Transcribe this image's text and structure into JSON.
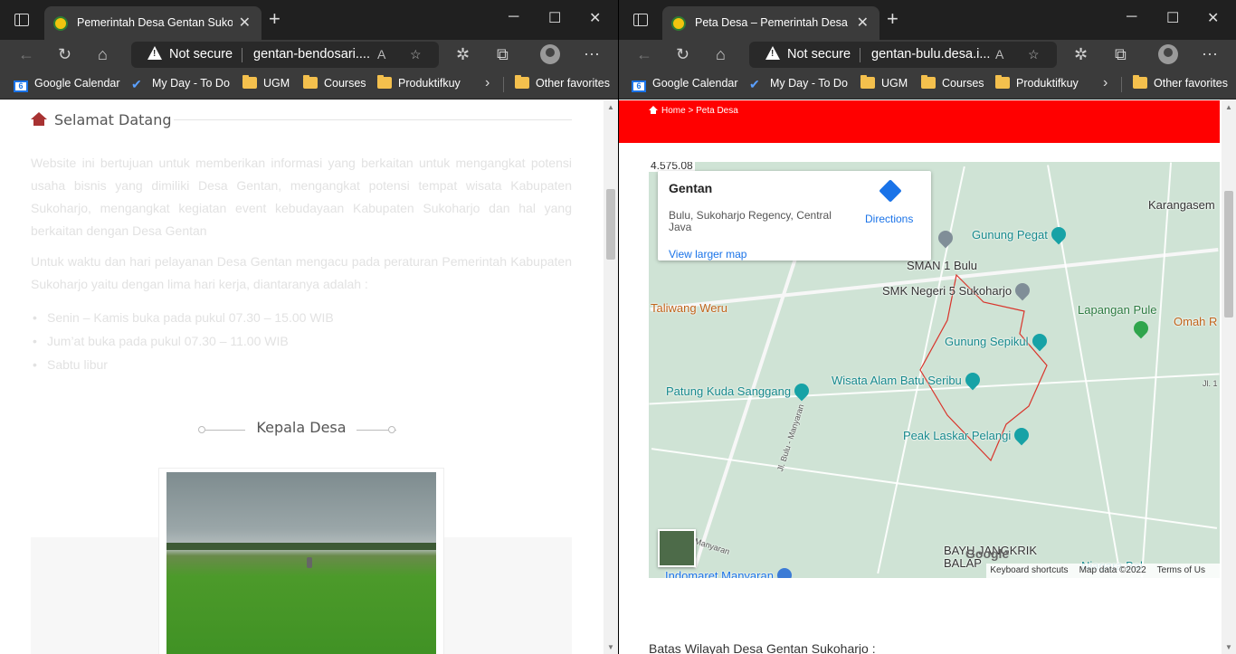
{
  "left_window": {
    "tab_title": "Pemerintah Desa Gentan Sukoharjo",
    "address": {
      "security": "Not secure",
      "url": "gentan-bendosari...."
    },
    "bookmarks": [
      "Google Calendar",
      "My Day - To Do",
      "UGM",
      "Courses",
      "Produktifkuy"
    ],
    "other_favorites": "Other favorites",
    "page": {
      "section_title": "Selamat Datang",
      "paragraph1": "Website ini bertujuan untuk memberikan informasi yang berkaitan untuk mengangkat potensi usaha bisnis yang dimiliki Desa Gentan, mengangkat potensi tempat wisata Kabupaten Sukoharjo, mengangkat kegiatan event kebudayaan Kabupaten Sukoharjo dan hal yang berkaitan dengan Desa Gentan",
      "paragraph2": "Untuk waktu dan hari pelayanan Desa Gentan mengacu pada peraturan Pemerintah Kabupaten Sukoharjo yaitu dengan lima hari kerja, diantaranya adalah :",
      "schedule": [
        "Senin – Kamis buka pada pukul 07.30 – 15.00 WIB",
        "Jum’at buka pada pukul 07.30 – 11.00 WIB",
        "Sabtu libur"
      ],
      "kepala_title": "Kepala Desa"
    }
  },
  "right_window": {
    "tab_title": "Peta Desa – Pemerintah Desa Gentan",
    "address": {
      "security": "Not secure",
      "url": "gentan-bulu.desa.i..."
    },
    "bookmarks": [
      "Google Calendar",
      "My Day - To Do",
      "UGM",
      "Courses",
      "Produktifkuy"
    ],
    "other_favorites": "Other favorites",
    "page": {
      "breadcrumb_home": "Home",
      "breadcrumb_current": "Peta Desa",
      "map": {
        "coord_fragment": "4.575.08",
        "card_title": "Gentan",
        "card_address": "Bulu, Sukoharjo Regency, Central Java",
        "card_link": "View larger map",
        "directions": "Directions",
        "places": {
          "karangasem": "Karangasem",
          "gunung_pegat": "Gunung Pegat",
          "sman1": "SMAN 1 Bulu",
          "smk5": "SMK Negeri 5 Sukoharjo",
          "taliwang": "Taliwang Weru",
          "lapangan": "Lapangan Pule",
          "omah": "Omah R",
          "sepikul": "Gunung Sepikul",
          "batu_seribu": "Wisata Alam Batu Seribu",
          "patung": "Patung Kuda Sanggang",
          "peak": "Peak Laskar Pelangi",
          "bayu": "BAYU JANGKRIK",
          "balap": "BALAP",
          "indomaret": "Indomaret Manyaran",
          "niagara": "Niagara Bal",
          "road_bulu": "Jl. Bulu - Manyaran",
          "road_manyaran": "Manyaran",
          "road_jl": "Jl. 1"
        },
        "google": "Google",
        "attribution": [
          "Keyboard shortcuts",
          "Map data ©2022",
          "Terms of Us"
        ]
      },
      "batas_text": "Batas Wilayah Desa Gentan Sukoharjo :"
    }
  },
  "colors": {
    "red_banner": "#ff0000",
    "heading_icon": "#a83232",
    "link_blue": "#1a73e8"
  }
}
